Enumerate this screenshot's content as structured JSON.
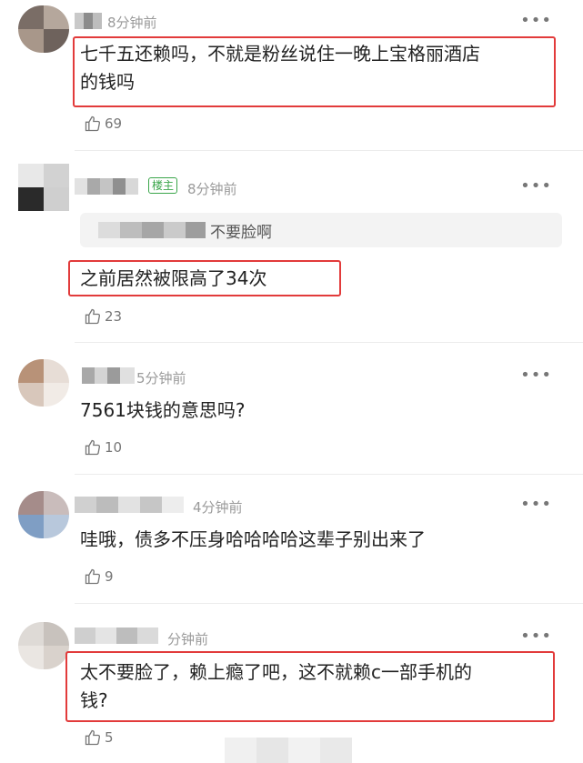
{
  "comments": [
    {
      "time": "8分钟前",
      "text_lines": [
        "七千五还赖吗，不就是粉丝说住一晚上宝格丽酒店",
        "的钱吗"
      ],
      "likes": "69",
      "more": "•••"
    },
    {
      "badge": "楼主",
      "time": "8分钟前",
      "quote_text": "不要脸啊",
      "text_lines": [
        "之前居然被限高了34次"
      ],
      "likes": "23",
      "more": "•••"
    },
    {
      "time": "5分钟前",
      "text_lines": [
        "7561块钱的意思吗?"
      ],
      "likes": "10",
      "more": "•••"
    },
    {
      "time": "4分钟前",
      "text_lines": [
        "哇哦，债多不压身哈哈哈哈这辈子别出来了"
      ],
      "likes": "9",
      "more": "•••"
    },
    {
      "time": "分钟前",
      "text_lines": [
        "太不要脸了，赖上瘾了吧，这不就赖c一部手机的",
        "钱?"
      ],
      "likes": "5",
      "more": "•••"
    }
  ],
  "colors": {
    "highlight": "#e23b3b",
    "badge_green": "#3aa64a"
  },
  "icons": {
    "like": "thumbs-up-icon",
    "more": "more-dots-icon"
  }
}
